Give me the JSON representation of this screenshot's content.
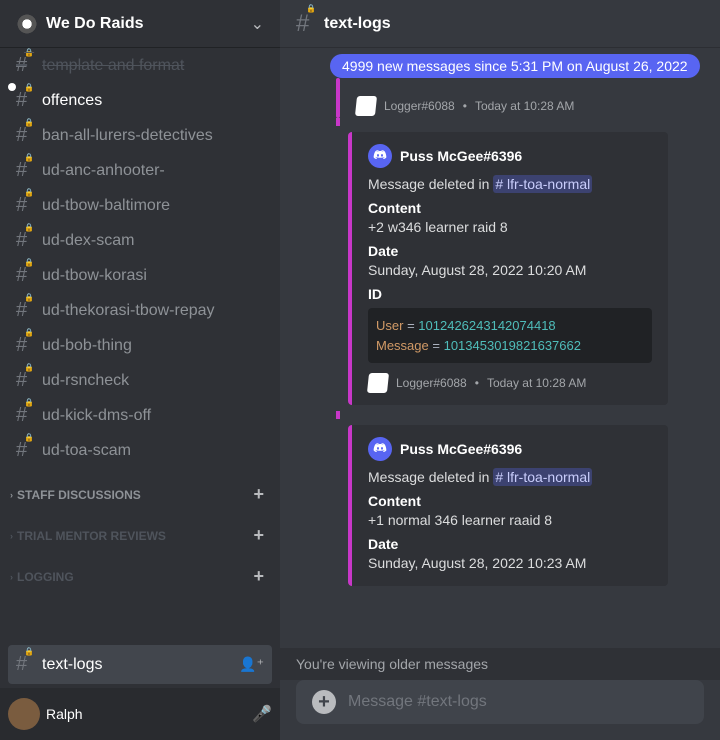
{
  "server": {
    "name": "We Do Raids"
  },
  "channels": [
    {
      "name": "template and format",
      "locked": true,
      "cut": true
    },
    {
      "name": "offences",
      "locked": true,
      "bold": true,
      "unread": true
    },
    {
      "name": "ban-all-lurers-detectives",
      "locked": true
    },
    {
      "name": "ud-anc-anhooter-",
      "locked": true
    },
    {
      "name": "ud-tbow-baltimore",
      "locked": true
    },
    {
      "name": "ud-dex-scam",
      "locked": true
    },
    {
      "name": "ud-tbow-korasi",
      "locked": true
    },
    {
      "name": "ud-thekorasi-tbow-repay",
      "locked": true
    },
    {
      "name": "ud-bob-thing",
      "locked": true
    },
    {
      "name": "ud-rsncheck",
      "locked": true
    },
    {
      "name": "ud-kick-dms-off",
      "locked": true
    },
    {
      "name": "ud-toa-scam",
      "locked": true
    }
  ],
  "categories": [
    {
      "name": "STAFF DISCUSSIONS",
      "dim": false
    },
    {
      "name": "TRIAL MENTOR REVIEWS",
      "dim": true
    },
    {
      "name": "LOGGING",
      "dim": true
    }
  ],
  "active_channel": {
    "name": "text-logs"
  },
  "current_user": {
    "name": "Ralph"
  },
  "header": {
    "title": "text-logs"
  },
  "banner": "4999 new messages since 5:31 PM on August 26, 2022",
  "messages": [
    {
      "footer_author": "Logger#6088",
      "footer_time": "Today at 10:28 AM"
    },
    {
      "embed_author": "Puss McGee#6396",
      "deleted_prefix": "Message deleted in ",
      "deleted_channel": "# lfr-toa-normal",
      "content_label": "Content",
      "content": "+2 w346 learner raid 8",
      "date_label": "Date",
      "date": "Sunday, August 28, 2022 10:20 AM",
      "id_label": "ID",
      "code": {
        "user_k": "User",
        "user_v": "1012426243142074418",
        "msg_k": "Message",
        "msg_v": "1013453019821637662"
      },
      "footer_author": "Logger#6088",
      "footer_time": "Today at 10:28 AM"
    },
    {
      "embed_author": "Puss McGee#6396",
      "deleted_prefix": "Message deleted in ",
      "deleted_channel": "# lfr-toa-normal",
      "content_label": "Content",
      "content": "+1 normal 346 learner raaid 8",
      "date_label": "Date",
      "date": "Sunday, August 28, 2022 10:23 AM"
    }
  ],
  "older_msg": "You're viewing older messages",
  "input_placeholder": "Message #text-logs"
}
